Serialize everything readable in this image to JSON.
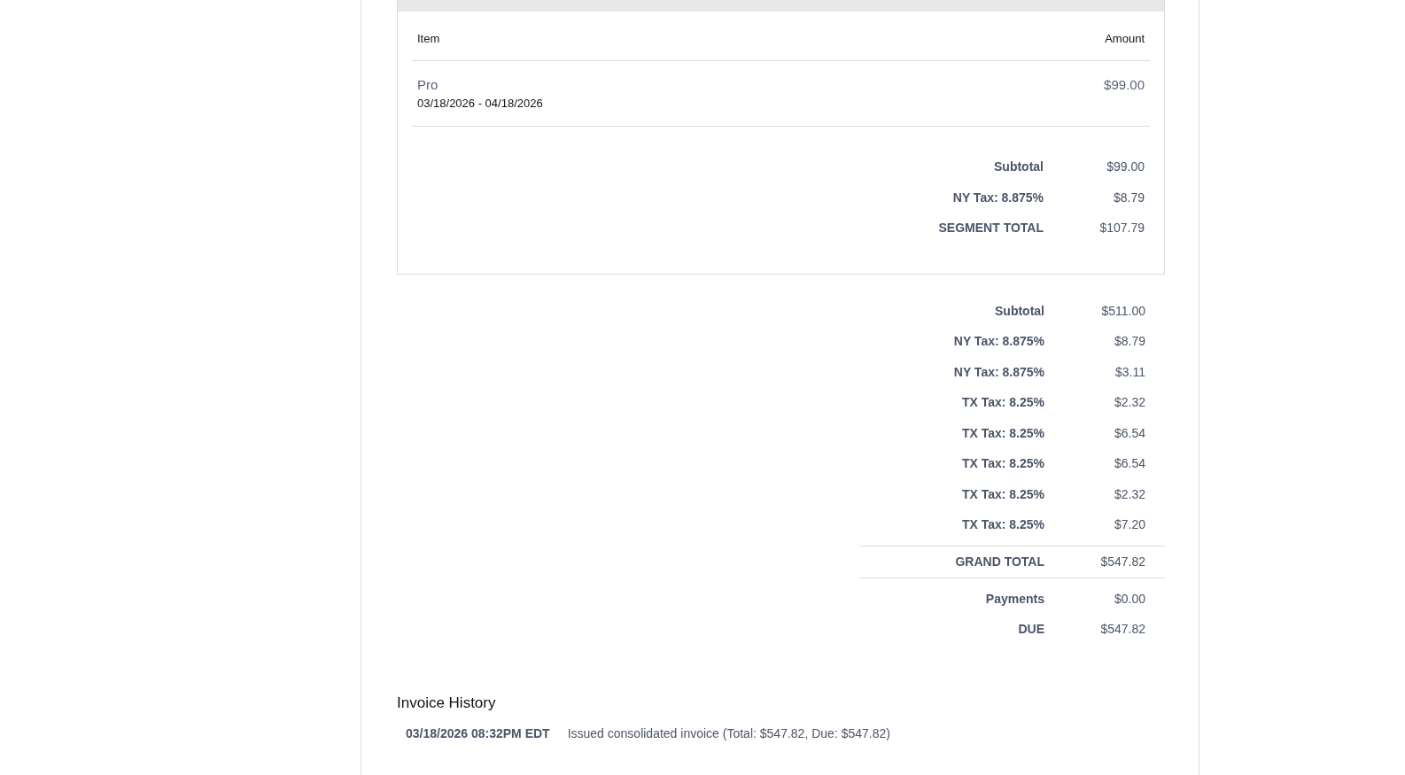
{
  "segment": {
    "columns": [
      "Item",
      "Amount"
    ],
    "lines": [
      {
        "name": "Pro",
        "period": "03/18/2026 - 04/18/2026",
        "amount": "$99.00"
      }
    ],
    "totals": [
      {
        "label": "Subtotal",
        "amount": "$99.00"
      },
      {
        "label": "NY Tax: 8.875%",
        "amount": "$8.79"
      },
      {
        "label": "SEGMENT TOTAL",
        "amount": "$107.79"
      }
    ]
  },
  "totals": [
    {
      "label": "Subtotal",
      "amount": "$511.00",
      "kind": "plain"
    },
    {
      "label": "NY Tax: 8.875%",
      "amount": "$8.79",
      "kind": "plain"
    },
    {
      "label": "NY Tax: 8.875%",
      "amount": "$3.11",
      "kind": "plain"
    },
    {
      "label": "TX Tax: 8.25%",
      "amount": "$2.32",
      "kind": "plain"
    },
    {
      "label": "TX Tax: 8.25%",
      "amount": "$6.54",
      "kind": "plain"
    },
    {
      "label": "TX Tax: 8.25%",
      "amount": "$6.54",
      "kind": "plain"
    },
    {
      "label": "TX Tax: 8.25%",
      "amount": "$2.32",
      "kind": "plain"
    },
    {
      "label": "TX Tax: 8.25%",
      "amount": "$7.20",
      "kind": "plain"
    },
    {
      "label": "GRAND TOTAL",
      "amount": "$547.82",
      "kind": "grand"
    },
    {
      "label": "Payments",
      "amount": "$0.00",
      "kind": "plain"
    },
    {
      "label": "DUE",
      "amount": "$547.82",
      "kind": "plain"
    }
  ],
  "history": {
    "title": "Invoice History",
    "entries": [
      {
        "time": "03/18/2026 08:32PM EDT",
        "text": "Issued consolidated invoice (Total: $547.82, Due: $547.82)"
      }
    ]
  }
}
